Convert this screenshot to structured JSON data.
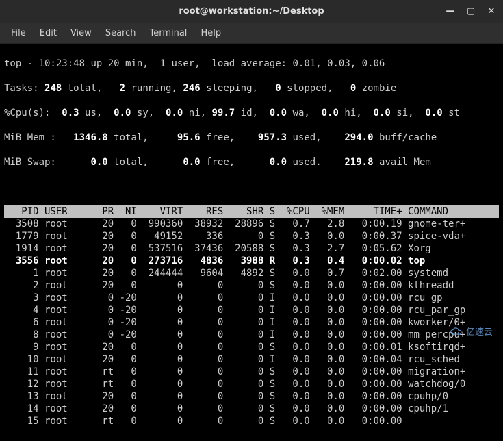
{
  "window": {
    "title": "root@workstation:~/Desktop",
    "controls": {
      "min": "—",
      "max": "▢",
      "close": "✕"
    }
  },
  "menu": {
    "file": "File",
    "edit": "Edit",
    "view": "View",
    "search": "Search",
    "terminal": "Terminal",
    "help": "Help"
  },
  "top": {
    "time": "10:23:48",
    "uptime": "20 min",
    "users": "1",
    "load1": "0.01",
    "load2": "0.03",
    "load3": "0.06",
    "tasks_total": "248",
    "tasks_running": "2",
    "tasks_sleeping": "246",
    "tasks_stopped": "0",
    "tasks_zombie": "0",
    "cpu_us": "0.3",
    "cpu_sy": "0.0",
    "cpu_ni": "0.0",
    "cpu_id": "99.7",
    "cpu_wa": "0.0",
    "cpu_hi": "0.0",
    "cpu_si": "0.0",
    "cpu_st": "0.0",
    "mem_total": "1346.8",
    "mem_free": "95.6",
    "mem_used": "957.3",
    "mem_buff": "294.0",
    "swap_total": "0.0",
    "swap_free": "0.0",
    "swap_used": "0.0",
    "swap_avail": "219.8"
  },
  "header": "   PID USER      PR  NI    VIRT    RES    SHR S  %CPU  %MEM     TIME+ COMMAND   ",
  "rows": [
    {
      "pid": "3508",
      "user": "root",
      "pr": "20",
      "ni": "0",
      "virt": "990360",
      "res": "38932",
      "shr": "28896",
      "s": "S",
      "cpu": "0.7",
      "mem": "2.8",
      "time": "0:00.19",
      "cmd": "gnome-ter+"
    },
    {
      "pid": "1779",
      "user": "root",
      "pr": "20",
      "ni": "0",
      "virt": "49152",
      "res": "336",
      "shr": "0",
      "s": "S",
      "cpu": "0.3",
      "mem": "0.0",
      "time": "0:00.37",
      "cmd": "spice-vda+"
    },
    {
      "pid": "1914",
      "user": "root",
      "pr": "20",
      "ni": "0",
      "virt": "537516",
      "res": "37436",
      "shr": "20588",
      "s": "S",
      "cpu": "0.3",
      "mem": "2.7",
      "time": "0:05.62",
      "cmd": "Xorg"
    },
    {
      "pid": "3556",
      "user": "root",
      "pr": "20",
      "ni": "0",
      "virt": "273716",
      "res": "4836",
      "shr": "3988",
      "s": "R",
      "cpu": "0.3",
      "mem": "0.4",
      "time": "0:00.02",
      "cmd": "top",
      "hl": true
    },
    {
      "pid": "1",
      "user": "root",
      "pr": "20",
      "ni": "0",
      "virt": "244444",
      "res": "9604",
      "shr": "4892",
      "s": "S",
      "cpu": "0.0",
      "mem": "0.7",
      "time": "0:02.00",
      "cmd": "systemd"
    },
    {
      "pid": "2",
      "user": "root",
      "pr": "20",
      "ni": "0",
      "virt": "0",
      "res": "0",
      "shr": "0",
      "s": "S",
      "cpu": "0.0",
      "mem": "0.0",
      "time": "0:00.00",
      "cmd": "kthreadd"
    },
    {
      "pid": "3",
      "user": "root",
      "pr": "0",
      "ni": "-20",
      "virt": "0",
      "res": "0",
      "shr": "0",
      "s": "I",
      "cpu": "0.0",
      "mem": "0.0",
      "time": "0:00.00",
      "cmd": "rcu_gp"
    },
    {
      "pid": "4",
      "user": "root",
      "pr": "0",
      "ni": "-20",
      "virt": "0",
      "res": "0",
      "shr": "0",
      "s": "I",
      "cpu": "0.0",
      "mem": "0.0",
      "time": "0:00.00",
      "cmd": "rcu_par_gp"
    },
    {
      "pid": "6",
      "user": "root",
      "pr": "0",
      "ni": "-20",
      "virt": "0",
      "res": "0",
      "shr": "0",
      "s": "I",
      "cpu": "0.0",
      "mem": "0.0",
      "time": "0:00.00",
      "cmd": "kworker/0+"
    },
    {
      "pid": "8",
      "user": "root",
      "pr": "0",
      "ni": "-20",
      "virt": "0",
      "res": "0",
      "shr": "0",
      "s": "I",
      "cpu": "0.0",
      "mem": "0.0",
      "time": "0:00.00",
      "cmd": "mm_percpu+"
    },
    {
      "pid": "9",
      "user": "root",
      "pr": "20",
      "ni": "0",
      "virt": "0",
      "res": "0",
      "shr": "0",
      "s": "S",
      "cpu": "0.0",
      "mem": "0.0",
      "time": "0:00.01",
      "cmd": "ksoftirqd+"
    },
    {
      "pid": "10",
      "user": "root",
      "pr": "20",
      "ni": "0",
      "virt": "0",
      "res": "0",
      "shr": "0",
      "s": "I",
      "cpu": "0.0",
      "mem": "0.0",
      "time": "0:00.04",
      "cmd": "rcu_sched"
    },
    {
      "pid": "11",
      "user": "root",
      "pr": "rt",
      "ni": "0",
      "virt": "0",
      "res": "0",
      "shr": "0",
      "s": "S",
      "cpu": "0.0",
      "mem": "0.0",
      "time": "0:00.00",
      "cmd": "migration+"
    },
    {
      "pid": "12",
      "user": "root",
      "pr": "rt",
      "ni": "0",
      "virt": "0",
      "res": "0",
      "shr": "0",
      "s": "S",
      "cpu": "0.0",
      "mem": "0.0",
      "time": "0:00.00",
      "cmd": "watchdog/0"
    },
    {
      "pid": "13",
      "user": "root",
      "pr": "20",
      "ni": "0",
      "virt": "0",
      "res": "0",
      "shr": "0",
      "s": "S",
      "cpu": "0.0",
      "mem": "0.0",
      "time": "0:00.00",
      "cmd": "cpuhp/0"
    },
    {
      "pid": "14",
      "user": "root",
      "pr": "20",
      "ni": "0",
      "virt": "0",
      "res": "0",
      "shr": "0",
      "s": "S",
      "cpu": "0.0",
      "mem": "0.0",
      "time": "0:00.00",
      "cmd": "cpuhp/1"
    },
    {
      "pid": "15",
      "user": "root",
      "pr": "rt",
      "ni": "0",
      "virt": "0",
      "res": "0",
      "shr": "0",
      "s": "S",
      "cpu": "0.0",
      "mem": "0.0",
      "time": "0:00.00",
      "cmd": ""
    }
  ],
  "watermark": "亿速云"
}
